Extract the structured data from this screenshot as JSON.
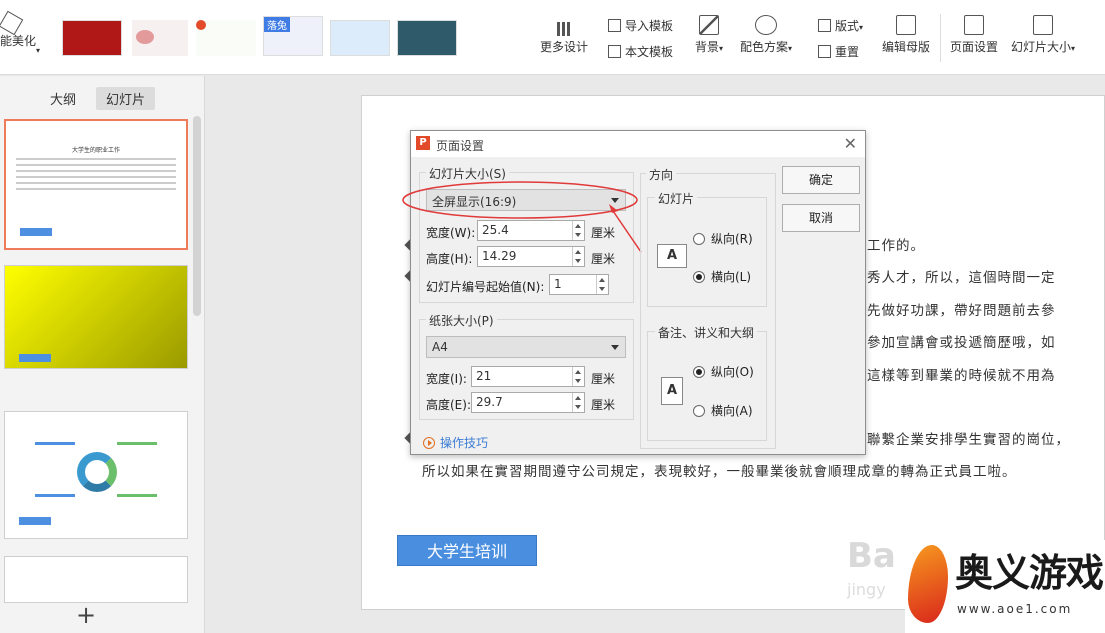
{
  "ribbon": {
    "left_label": "能美化",
    "new_tag": "落兔",
    "more_design": "更多设计",
    "import_template": "导入模板",
    "this_template": "本文模板",
    "background": "背景",
    "color_scheme": "配色方案",
    "layout": "版式",
    "reset": "重置",
    "edit_master": "编辑母版",
    "page_setup": "页面设置",
    "slide_size": "幻灯片大小"
  },
  "sidebar": {
    "tab_outline": "大纲",
    "tab_slides": "幻灯片",
    "thumb1_title": "大学生的职业工作",
    "thumb_btn": "大学生培训",
    "add": "+"
  },
  "canvas": {
    "lines": [
      "工作的。",
      "秀人才，所以，這個時間一定",
      "先做好功課，帶好問題前去參",
      "參加宣講會或投遞簡歷哦，如",
      "這樣等到畢業的時候就不用為",
      "聯繫企業安排學生實習的崗位，",
      "所以如果在實習期間遵守公司規定，表現較好，一般畢業後就會順理成章的轉為正式員工啦。"
    ],
    "button": "大学生培训",
    "watermark": "Ba",
    "watermark_sub": "jingy"
  },
  "dialog": {
    "title": "页面设置",
    "slide_size_group": "幻灯片大小(S)",
    "slide_size_value": "全屏显示(16:9)",
    "width_label": "宽度(W):",
    "width_value": "25.4",
    "height_label": "高度(H):",
    "height_value": "14.29",
    "unit": "厘米",
    "start_num_label": "幻灯片编号起始值(N):",
    "start_num_value": "1",
    "paper_group": "纸张大小(P)",
    "paper_value": "A4",
    "paper_width_label": "宽度(I):",
    "paper_width_value": "21",
    "paper_height_label": "高度(E):",
    "paper_height_value": "29.7",
    "orientation_group": "方向",
    "slides_subgroup": "幻灯片",
    "portrait_r": "纵向(R)",
    "landscape_l": "横向(L)",
    "notes_subgroup": "备注、讲义和大纲",
    "portrait_o": "纵向(O)",
    "landscape_a": "横向(A)",
    "ok": "确定",
    "cancel": "取消",
    "tips": "操作技巧",
    "page_icon_letter": "A"
  },
  "logo": {
    "name": "奥义游戏网",
    "url": "www.aoe1.com"
  },
  "colors": {
    "accent": "#4a8ee0",
    "annotation": "#e03a3a",
    "selected_thumb": "#f07b5b"
  }
}
